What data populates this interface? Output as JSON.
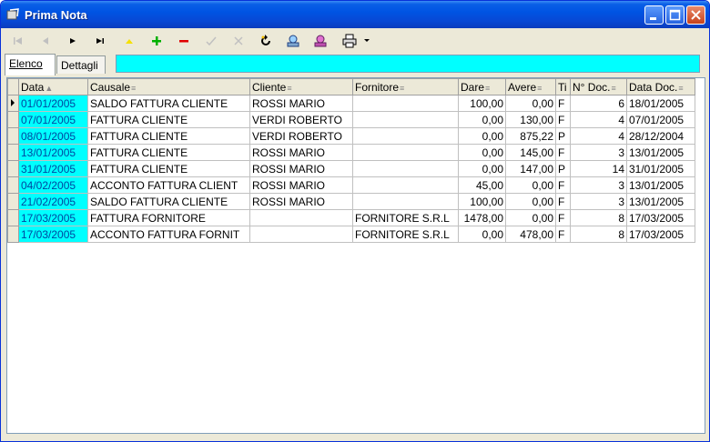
{
  "window": {
    "title": "Prima Nota"
  },
  "tabs": [
    {
      "label": "Elenco"
    },
    {
      "label": "Dettagli"
    }
  ],
  "table": {
    "headers": [
      "Data",
      "Causale",
      "Cliente",
      "Fornitore",
      "Dare",
      "Avere",
      "Ti",
      "N° Doc.",
      "Data Doc."
    ],
    "rows": [
      [
        "01/01/2005",
        "SALDO FATTURA CLIENTE",
        "ROSSI MARIO",
        "",
        "100,00",
        "0,00",
        "F",
        "6",
        "18/01/2005"
      ],
      [
        "07/01/2005",
        "FATTURA CLIENTE",
        "VERDI ROBERTO",
        "",
        "0,00",
        "130,00",
        "F",
        "4",
        "07/01/2005"
      ],
      [
        "08/01/2005",
        "FATTURA CLIENTE",
        "VERDI ROBERTO",
        "",
        "0,00",
        "875,22",
        "P",
        "4",
        "28/12/2004"
      ],
      [
        "13/01/2005",
        "FATTURA CLIENTE",
        "ROSSI MARIO",
        "",
        "0,00",
        "145,00",
        "F",
        "3",
        "13/01/2005"
      ],
      [
        "31/01/2005",
        "FATTURA CLIENTE",
        "ROSSI MARIO",
        "",
        "0,00",
        "147,00",
        "P",
        "14",
        "31/01/2005"
      ],
      [
        "04/02/2005",
        "ACCONTO FATTURA CLIENT",
        "ROSSI MARIO",
        "",
        "45,00",
        "0,00",
        "F",
        "3",
        "13/01/2005"
      ],
      [
        "21/02/2005",
        "SALDO FATTURA CLIENTE",
        "ROSSI MARIO",
        "",
        "100,00",
        "0,00",
        "F",
        "3",
        "13/01/2005"
      ],
      [
        "17/03/2005",
        "FATTURA FORNITORE",
        "",
        "FORNITORE S.R.L",
        "1478,00",
        "0,00",
        "F",
        "8",
        "17/03/2005"
      ],
      [
        "17/03/2005",
        "ACCONTO FATTURA FORNIT",
        "",
        "FORNITORE S.R.L",
        "0,00",
        "478,00",
        "F",
        "8",
        "17/03/2005"
      ]
    ]
  },
  "colors": {
    "accent_cyan": "#00ffff",
    "titlebar": "#0054e3"
  }
}
